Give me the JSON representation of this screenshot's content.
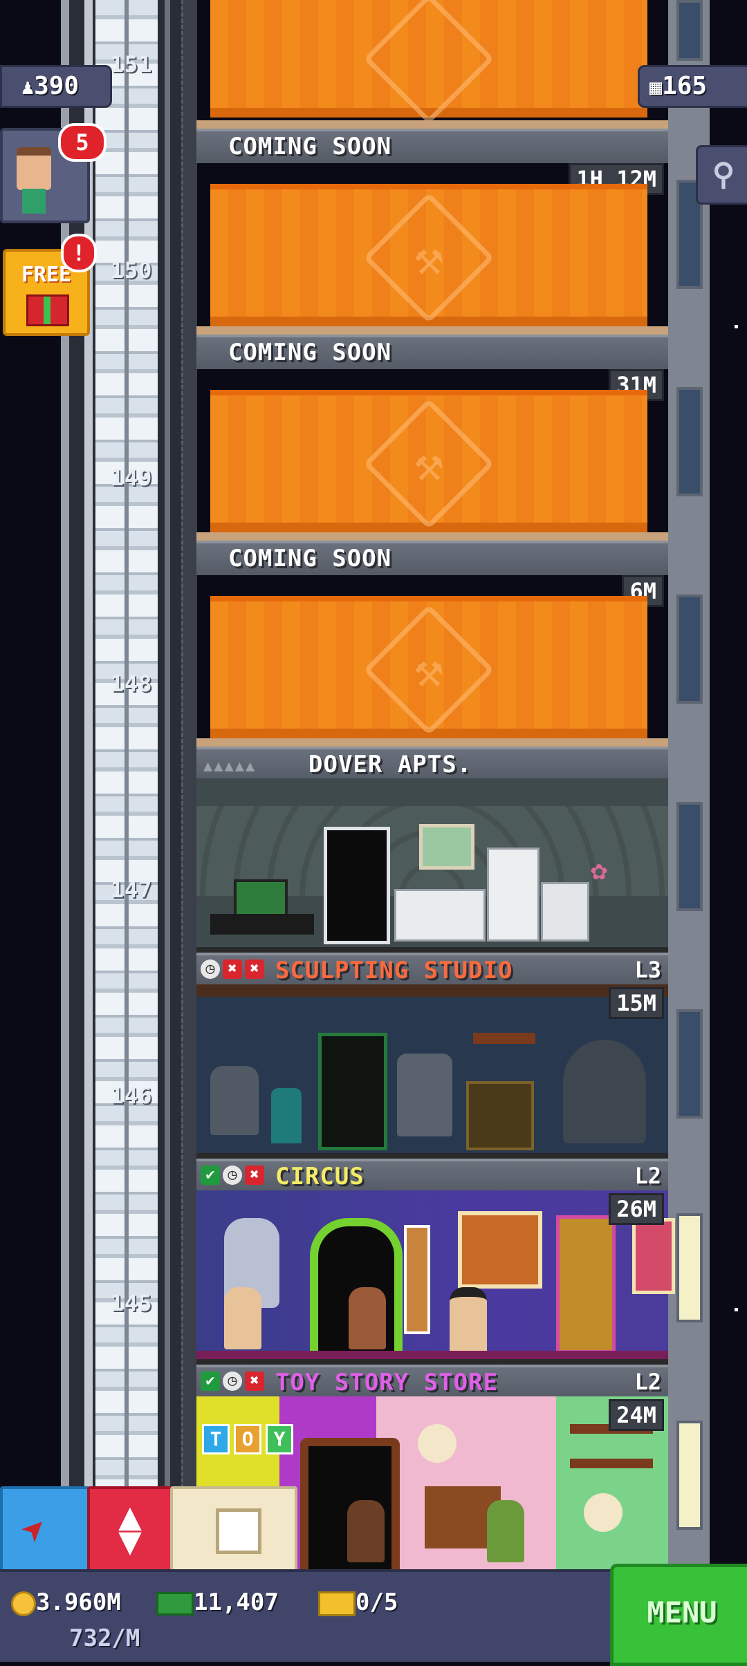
{
  "hud": {
    "population": "390",
    "floors_count": "165",
    "visitor_badge": "5",
    "free_label": "FREE",
    "free_badge": "!"
  },
  "floor_numbers": [
    "151",
    "150",
    "149",
    "148",
    "147",
    "146",
    "145"
  ],
  "floors": [
    {
      "title": "COMING SOON",
      "timer": "1H 12M"
    },
    {
      "title": "COMING SOON",
      "timer": "31M"
    },
    {
      "title": "COMING SOON",
      "timer": "6M"
    },
    {
      "title": "DOVER APTS."
    },
    {
      "title": "SCULPTING STUDIO",
      "level": "L3",
      "timer": "15M"
    },
    {
      "title": "CIRCUS",
      "level": "L2",
      "timer": "26M"
    },
    {
      "title": "TOY STORY STORE",
      "level": "L2",
      "timer": "24M"
    }
  ],
  "toy_sign": [
    "T",
    "O",
    "Y"
  ],
  "bottom": {
    "coins": "3.960M",
    "coins_rate": "732/M",
    "bux": "11,407",
    "tickets": "0/5",
    "menu_label": "MENU"
  },
  "colors": {
    "construction": "#f38a1c",
    "sculpting_title": "#ff6a3d",
    "circus_title": "#f4ec66",
    "toy_title": "#e060e8",
    "menu": "#39c13a"
  },
  "icons": [
    "person-icon",
    "building-icon",
    "search-icon",
    "gift-icon",
    "rocket-icon",
    "elevator-icon",
    "box-icon",
    "coin-icon",
    "bux-icon",
    "ticket-icon",
    "clock-icon",
    "check-icon",
    "x-icon"
  ]
}
